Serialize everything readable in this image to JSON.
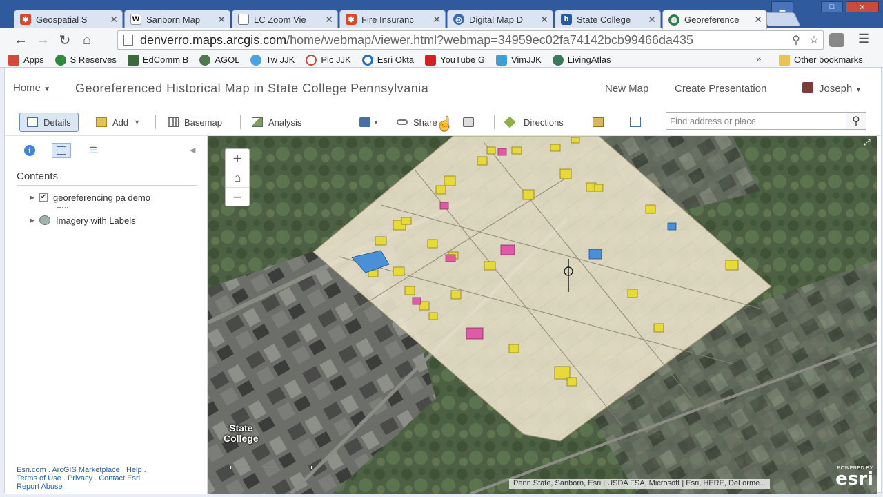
{
  "browser": {
    "tabs": [
      {
        "title": "Geospatial S",
        "icon": "pinwheel-icon",
        "color": "#e0452a"
      },
      {
        "title": "Sanborn Map",
        "icon": "wikipedia-icon",
        "color": "#ffffff"
      },
      {
        "title": "LC Zoom Vie",
        "icon": "document-icon",
        "color": "#ffffff"
      },
      {
        "title": "Fire Insuranc",
        "icon": "pinwheel-icon",
        "color": "#e0452a"
      },
      {
        "title": "Digital Map D",
        "icon": "globe-icon",
        "color": "#3a6ab5"
      },
      {
        "title": "State College",
        "icon": "b-icon",
        "color": "#2a5a9e"
      },
      {
        "title": "Georeference",
        "icon": "arcgis-icon",
        "color": "#2e7d4f"
      }
    ],
    "window_controls": {
      "minimize": "▁",
      "restore": "□",
      "close": "✕"
    },
    "url_host": "denverro.maps.arcgis.com",
    "url_path": "/home/webmap/viewer.html?webmap=34959ec02fa74142bcb99466da435",
    "bookmarks": [
      {
        "label": "Apps",
        "color": "#d24a3a"
      },
      {
        "label": "S Reserves",
        "color": "#2e8b3d"
      },
      {
        "label": "EdComm B",
        "color": "#3c6a3c"
      },
      {
        "label": "AGOL",
        "color": "#4f7a4f"
      },
      {
        "label": "Tw JJK",
        "color": "#4aa3e0"
      },
      {
        "label": "Pic JJK",
        "color": "#d44638"
      },
      {
        "label": "Esri Okta",
        "color": "#1f6fc4"
      },
      {
        "label": "YouTube G",
        "color": "#d42020"
      },
      {
        "label": "VimJJK",
        "color": "#3aa0d8"
      },
      {
        "label": "LivingAtlas",
        "color": "#3a7a5a"
      }
    ],
    "bookmarks_overflow": "»",
    "other_bookmarks": "Other bookmarks"
  },
  "app": {
    "home_label": "Home",
    "title": "Georeferenced Historical Map in State College Pennsylvania",
    "new_map": "New Map",
    "create_presentation": "Create Presentation",
    "user": "Joseph",
    "toolbar": {
      "details": "Details",
      "add": "Add",
      "basemap": "Basemap",
      "analysis": "Analysis",
      "share": "Share",
      "directions": "Directions"
    },
    "search_placeholder": "Find address or place"
  },
  "sidebar": {
    "contents_heading": "Contents",
    "layers": [
      {
        "name": "georeferencing pa demo",
        "checked": true
      },
      {
        "name": "Imagery with Labels",
        "checked": false
      }
    ],
    "footer_links": [
      "Esri.com",
      "ArcGIS Marketplace",
      "Help",
      "Terms of Use",
      "Privacy",
      "Contact Esri",
      "Report Abuse"
    ]
  },
  "map": {
    "place_label_line1": "State",
    "place_label_line2": "College",
    "attribution": "Penn State, Sanborn, Esri | USDA FSA, Microsoft | Esri, HERE, DeLorme...",
    "logo_powered": "POWERED BY",
    "logo_name": "esri"
  }
}
